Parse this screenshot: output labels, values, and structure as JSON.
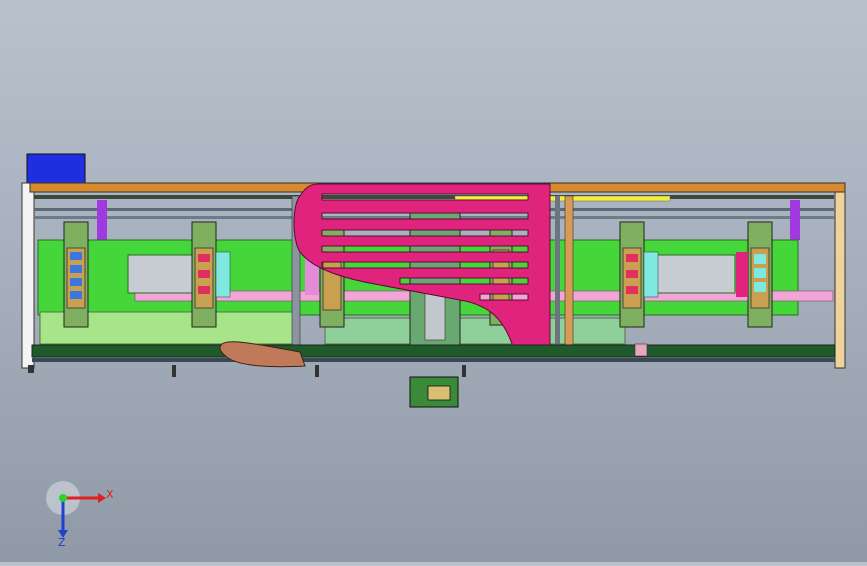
{
  "view": {
    "background_top": "#b9c1cc",
    "background_bottom": "#9099a6",
    "model": {
      "frame_color": "#d98a2f",
      "panel_green": "#45d63a",
      "accent_magenta": "#e0237d",
      "motor_blue": "#1f2fe0",
      "rail_pink": "#f3a5d8",
      "belt_brown": "#c07a5a"
    }
  },
  "triad": {
    "x_label": "X",
    "z_label": "Z",
    "x_color": "#e0201e",
    "z_color": "#2040d0",
    "origin_color": "#2bd42b"
  }
}
